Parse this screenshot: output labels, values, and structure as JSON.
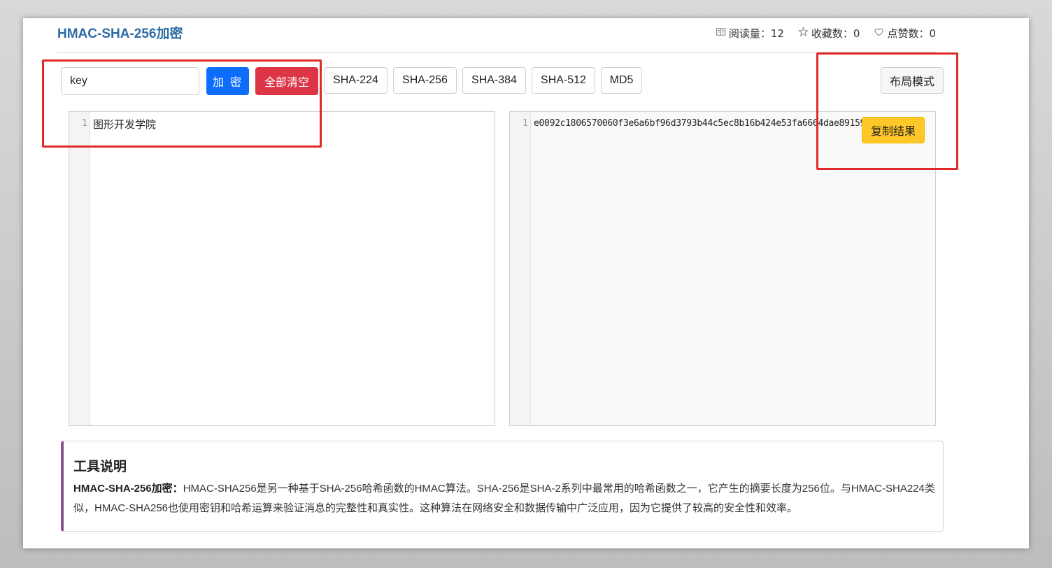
{
  "header": {
    "title": "HMAC-SHA-256加密",
    "stats": {
      "reads_label": "阅读量：12",
      "favorites_label": "收藏数：0",
      "likes_label": "点赞数：0"
    }
  },
  "toolbar": {
    "key_value": "key",
    "encrypt_label": "加 密",
    "clear_label": "全部清空",
    "algorithms": [
      "SHA-224",
      "SHA-256",
      "SHA-384",
      "SHA-512",
      "MD5"
    ],
    "layout_label": "布局模式"
  },
  "input_editor": {
    "line_number": "1",
    "text": "图形开发学院"
  },
  "output_editor": {
    "line_number": "1",
    "text": "e0092c1806570060f3e6a6bf96d3793b44c5ec8b16b424e53fa6664dae891594",
    "copy_label": "复制结果"
  },
  "description": {
    "title": "工具说明",
    "lead": "HMAC-SHA-256加密：",
    "body": "HMAC-SHA256是另一种基于SHA-256哈希函数的HMAC算法。SHA-256是SHA-2系列中最常用的哈希函数之一，它产生的摘要长度为256位。与HMAC-SHA224类似，HMAC-SHA256也使用密钥和哈希运算来验证消息的完整性和真实性。这种算法在网络安全和数据传输中广泛应用，因为它提供了较高的安全性和效率。"
  },
  "colors": {
    "title": "#2e6da4",
    "primary": "#0d6efd",
    "danger": "#dc3545",
    "warning": "#ffc828",
    "annotation": "#e02a2a",
    "desc_accent": "#8a4f8c"
  },
  "icons": {
    "reads": "book-icon",
    "favorites": "star-icon",
    "likes": "heart-icon"
  }
}
